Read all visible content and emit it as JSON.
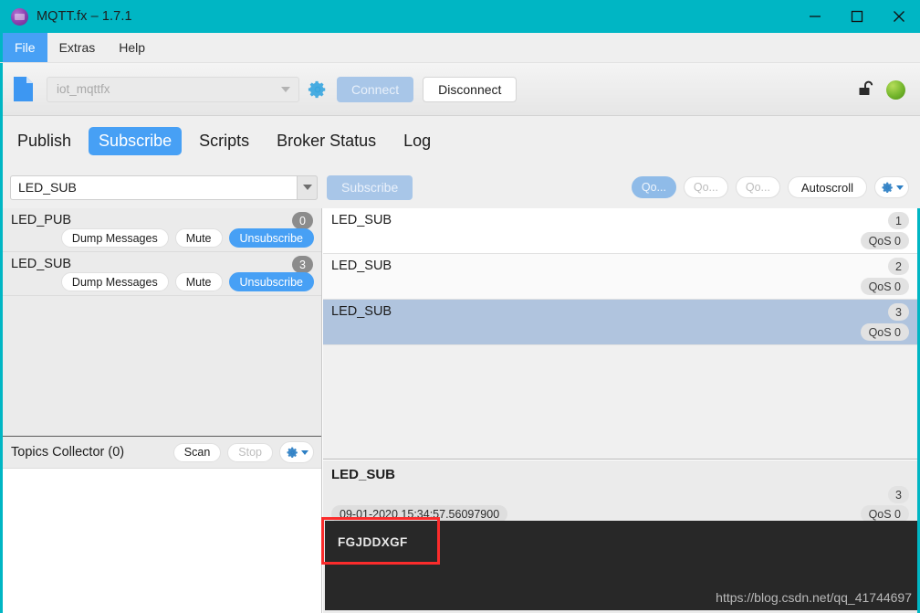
{
  "window": {
    "title": "MQTT.fx – 1.7.1",
    "logo_icon": "mqtt-logo-icon",
    "controls": [
      {
        "name": "minimize",
        "icon": "minimize-icon"
      },
      {
        "name": "maximize",
        "icon": "maximize-icon"
      },
      {
        "name": "close",
        "icon": "close-icon"
      }
    ]
  },
  "menubar": {
    "items": [
      {
        "label": "File",
        "active": true
      },
      {
        "label": "Extras",
        "active": false
      },
      {
        "label": "Help",
        "active": false
      }
    ]
  },
  "toolbar": {
    "document_icon": "document-icon",
    "profile": {
      "value": "iot_mqttfx",
      "disabled": true
    },
    "settings_icon": "gear-icon",
    "connect_label": "Connect",
    "disconnect_label": "Disconnect",
    "lock_icon": "unlocked-padlock-icon",
    "status": {
      "icon": "status-dot-icon",
      "color": "#74b62c"
    }
  },
  "tabs": [
    {
      "label": "Publish",
      "active": false
    },
    {
      "label": "Subscribe",
      "active": true
    },
    {
      "label": "Scripts",
      "active": false
    },
    {
      "label": "Broker Status",
      "active": false
    },
    {
      "label": "Log",
      "active": false
    }
  ],
  "subscribe_bar": {
    "topic_value": "LED_SUB",
    "topic_placeholder": "Topic",
    "subscribe_label": "Subscribe",
    "qos_buttons": [
      {
        "label": "Qo...",
        "selected": true
      },
      {
        "label": "Qo...",
        "selected": false
      },
      {
        "label": "Qo...",
        "selected": false
      }
    ],
    "autoscroll_label": "Autoscroll",
    "options_icon": "gear-dropdown-icon"
  },
  "subscriptions": {
    "items": [
      {
        "topic": "LED_PUB",
        "count": "0",
        "dump_label": "Dump Messages",
        "mute_label": "Mute",
        "unsubscribe_label": "Unsubscribe"
      },
      {
        "topic": "LED_SUB",
        "count": "3",
        "dump_label": "Dump Messages",
        "mute_label": "Mute",
        "unsubscribe_label": "Unsubscribe"
      }
    ]
  },
  "topics_collector": {
    "title": "Topics Collector (0)",
    "scan_label": "Scan",
    "stop_label": "Stop",
    "options_icon": "gear-dropdown-icon"
  },
  "messages": [
    {
      "topic": "LED_SUB",
      "index": "1",
      "qos": "QoS 0",
      "selected": false
    },
    {
      "topic": "LED_SUB",
      "index": "2",
      "qos": "QoS 0",
      "selected": false
    },
    {
      "topic": "LED_SUB",
      "index": "3",
      "qos": "QoS 0",
      "selected": true
    }
  ],
  "detail": {
    "topic": "LED_SUB",
    "index": "3",
    "qos": "QoS 0",
    "timestamp": "09-01-2020 15:34:57.56097900",
    "payload": "FGJDDXGF",
    "watermark": "https://blog.csdn.net/qq_41744697"
  },
  "annotation": {
    "color": "#fb2c2c"
  },
  "colors": {
    "titlebar": "#00b6c4",
    "accent_blue": "#47a0f5",
    "selected_row": "#b0c4de",
    "payload_bg": "#282828"
  }
}
